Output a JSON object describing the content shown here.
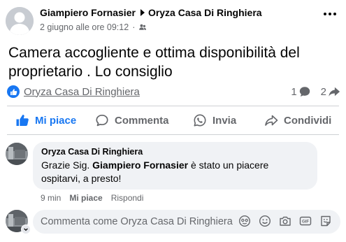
{
  "post": {
    "author": "Giampiero Fornasier",
    "target_page": "Oryza Casa Di Ringhiera",
    "timestamp": "2 giugno alle ore 09:12",
    "text": "Camera accogliente e ottima disponibilità del proprietario . Lo consiglio",
    "reacted_by": "Oryza Casa Di Ringhiera",
    "comment_count": "1",
    "share_count": "2"
  },
  "actions": {
    "like": "Mi piace",
    "comment": "Commenta",
    "share_whatsapp": "Invia",
    "share": "Condividi"
  },
  "comment": {
    "author": "Oryza Casa Di Ringhiera",
    "text_before": "Grazie Sig. ",
    "mention": "Giampiero Fornasier",
    "text_after": " è stato un piacere ospitarvi, a presto!",
    "time": "9 min",
    "like": "Mi piace",
    "reply": "Rispondi"
  },
  "composer": {
    "placeholder": "Commenta come Oryza Casa Di Ringhiera"
  },
  "colors": {
    "accent": "#1877f2",
    "secondary_text": "#65676b",
    "bubble_bg": "#f0f2f5"
  }
}
